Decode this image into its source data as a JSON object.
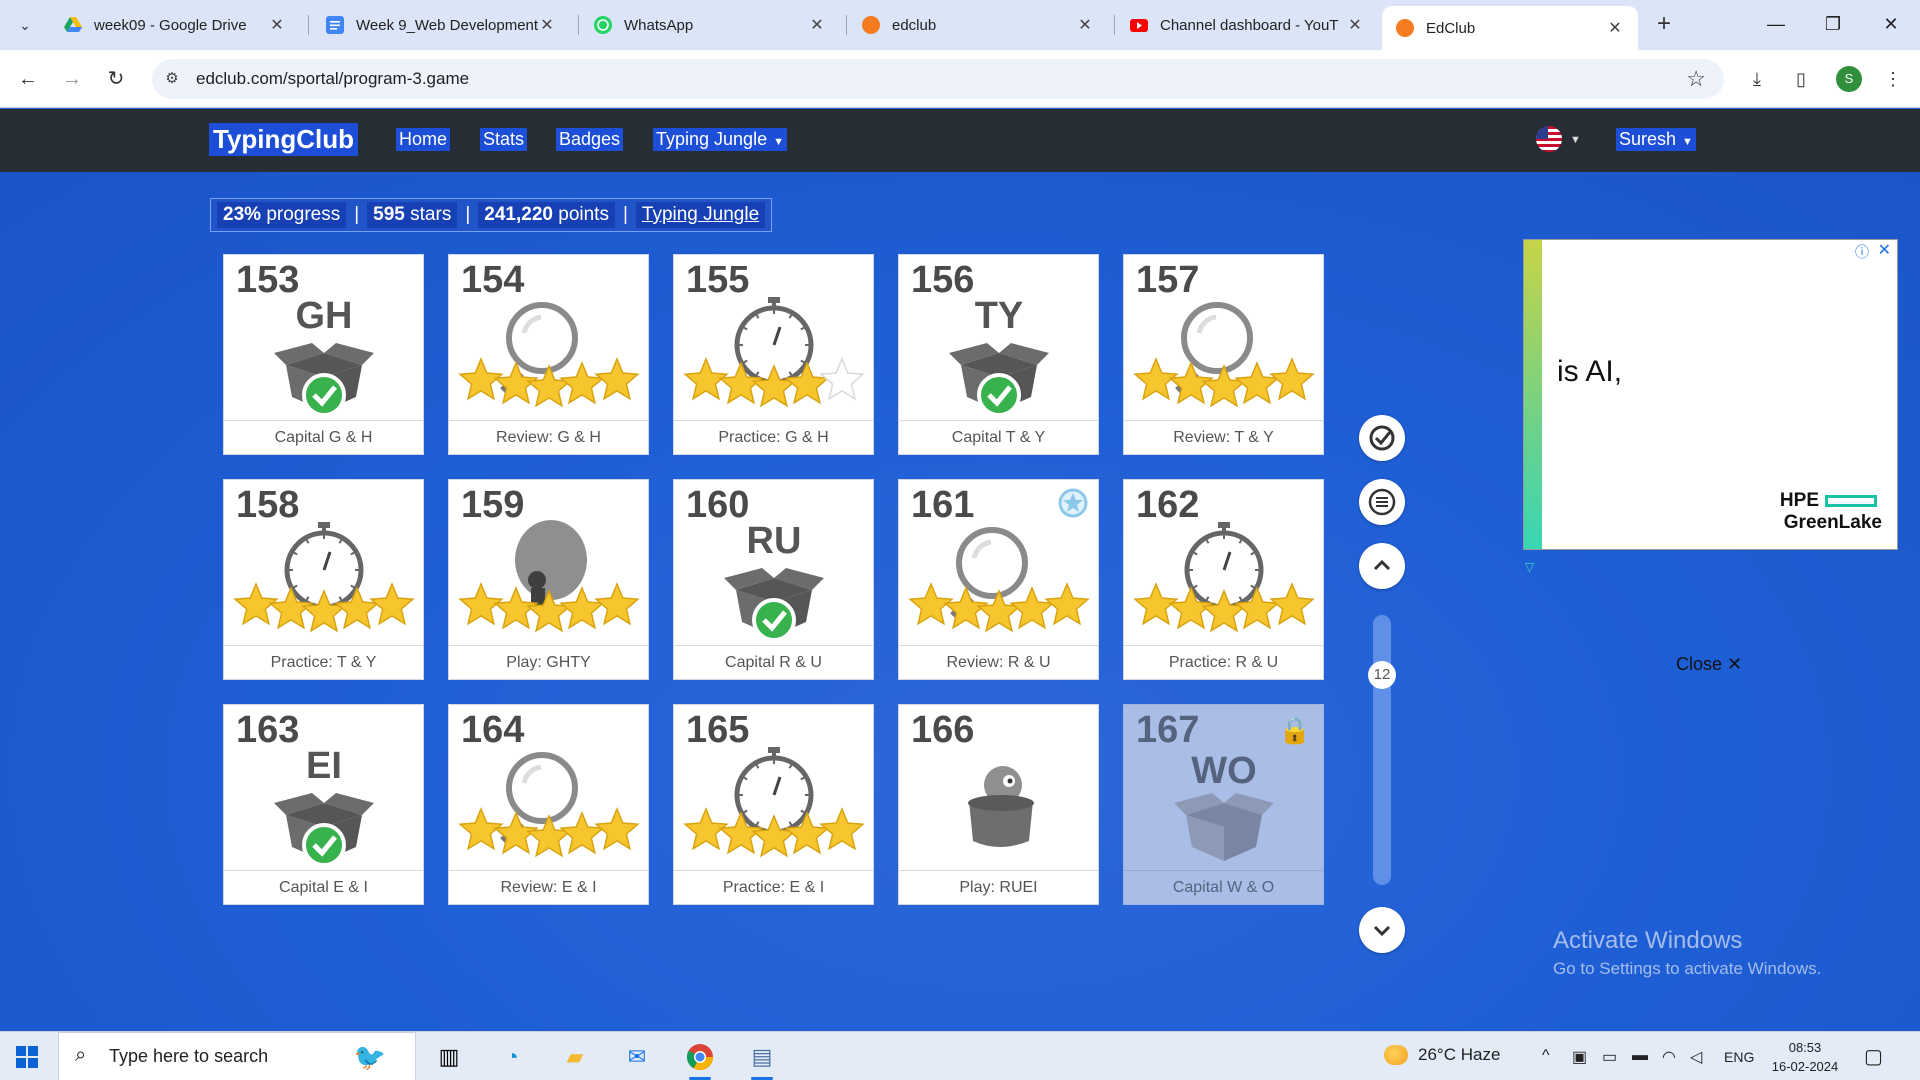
{
  "browser": {
    "tabs": [
      {
        "title": "week09 - Google Drive",
        "favicon": "google-drive-icon",
        "color": "#1fa463"
      },
      {
        "title": "Week 9_Web Development",
        "favicon": "google-docs-icon",
        "color": "#4285f4"
      },
      {
        "title": "WhatsApp",
        "favicon": "whatsapp-icon",
        "color": "#25d366"
      },
      {
        "title": "edclub",
        "favicon": "edclub-icon",
        "color": "#f47b20"
      },
      {
        "title": "Channel dashboard - YouT",
        "favicon": "youtube-icon",
        "color": "#ff0000"
      },
      {
        "title": "EdClub",
        "favicon": "edclub-icon",
        "color": "#f47b20"
      }
    ],
    "url": "edclub.com/sportal/program-3.game"
  },
  "site": {
    "logo": "TypingClub",
    "nav": {
      "home": "Home",
      "stats": "Stats",
      "badges": "Badges",
      "program": "Typing Jungle"
    },
    "user": "Suresh"
  },
  "progress": {
    "percent": "23%",
    "percent_label": "progress",
    "stars": "595",
    "stars_label": "stars",
    "points": "241,220",
    "points_label": "points",
    "program_link": "Typing Jungle"
  },
  "lessons": [
    {
      "num": "153",
      "caption": "Capital G & H",
      "type": "capital",
      "letters": "GH",
      "stars": null
    },
    {
      "num": "154",
      "caption": "Review: G & H",
      "type": "review",
      "letters": "",
      "stars": 5
    },
    {
      "num": "155",
      "caption": "Practice: G & H",
      "type": "practice",
      "letters": "",
      "stars": 4
    },
    {
      "num": "156",
      "caption": "Capital T & Y",
      "type": "capital",
      "letters": "TY",
      "stars": null
    },
    {
      "num": "157",
      "caption": "Review: T & Y",
      "type": "review",
      "letters": "",
      "stars": 5
    },
    {
      "num": "158",
      "caption": "Practice: T & Y",
      "type": "practice",
      "letters": "",
      "stars": 5
    },
    {
      "num": "159",
      "caption": "Play: GHTY",
      "type": "play-balloon",
      "letters": "",
      "stars": 5
    },
    {
      "num": "160",
      "caption": "Capital R & U",
      "type": "capital",
      "letters": "RU",
      "stars": null
    },
    {
      "num": "161",
      "caption": "Review: R & U",
      "type": "review",
      "letters": "",
      "stars": 5,
      "badge": true
    },
    {
      "num": "162",
      "caption": "Practice: R & U",
      "type": "practice",
      "letters": "",
      "stars": 5
    },
    {
      "num": "163",
      "caption": "Capital E & I",
      "type": "capital",
      "letters": "EI",
      "stars": null
    },
    {
      "num": "164",
      "caption": "Review: E & I",
      "type": "review",
      "letters": "",
      "stars": 5
    },
    {
      "num": "165",
      "caption": "Practice: E & I",
      "type": "practice",
      "letters": "",
      "stars": 5
    },
    {
      "num": "166",
      "caption": "Play: RUEI",
      "type": "play-pot",
      "letters": "",
      "stars": null
    },
    {
      "num": "167",
      "caption": "Capital W & O",
      "type": "capital-locked",
      "letters": "WO",
      "stars": null,
      "locked": true
    }
  ],
  "sidebar": {
    "scroll_level": "12"
  },
  "ad": {
    "text": "is AI,",
    "brand_line1": "HPE",
    "brand_line2": "GreenLake",
    "close_label": "Close"
  },
  "watermark": {
    "line1": "Activate Windows",
    "line2": "Go to Settings to activate Windows."
  },
  "taskbar": {
    "search_placeholder": "Type here to search",
    "weather": "26°C  Haze",
    "language": "ENG",
    "time": "08:53",
    "date": "16-02-2024"
  },
  "colors": {
    "page_bg": "#1f5fd6",
    "header_bg": "#262d35",
    "accent": "#1c4ed8",
    "star": "#f7c62f",
    "check": "#37b24d"
  }
}
